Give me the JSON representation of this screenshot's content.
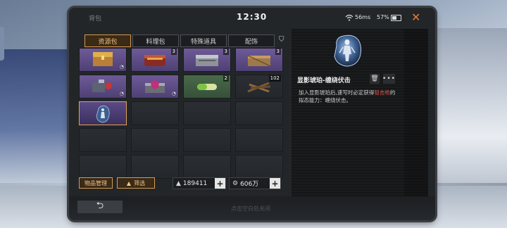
{
  "status": {
    "title": "背包",
    "time": "12:30",
    "ping": "56ms",
    "battery": "57%",
    "battery_level": 0.57
  },
  "tabs": [
    {
      "label": "资源包",
      "active": true
    },
    {
      "label": "料理包",
      "active": false
    },
    {
      "label": "特殊道具",
      "active": false
    },
    {
      "label": "配饰",
      "active": false
    }
  ],
  "grid": [
    {
      "row": 0,
      "col": 0,
      "kind": "purple",
      "icon": "treasure-chest-icon",
      "qty": "",
      "check": true
    },
    {
      "row": 0,
      "col": 1,
      "kind": "purple",
      "icon": "red-chest-icon",
      "qty": "3",
      "check": false
    },
    {
      "row": 0,
      "col": 2,
      "kind": "purple",
      "icon": "metal-case-icon",
      "qty": "3",
      "check": false
    },
    {
      "row": 0,
      "col": 3,
      "kind": "purple",
      "icon": "wooden-crate-icon",
      "qty": "3",
      "check": false
    },
    {
      "row": 1,
      "col": 0,
      "kind": "purple",
      "icon": "supply-bundle-icon",
      "qty": "",
      "check": true
    },
    {
      "row": 1,
      "col": 1,
      "kind": "purple",
      "icon": "shield-box-icon",
      "qty": "",
      "check": true
    },
    {
      "row": 1,
      "col": 2,
      "kind": "green",
      "icon": "capsule-icon",
      "qty": "2",
      "check": false
    },
    {
      "row": 1,
      "col": 3,
      "kind": "plain",
      "icon": "wood-pile-icon",
      "qty": "102",
      "check": false
    },
    {
      "row": 2,
      "col": 0,
      "kind": "selected",
      "icon": "amber-icon",
      "qty": "",
      "check": false
    }
  ],
  "buttons": {
    "manage": "物品管理",
    "filter": "筛选"
  },
  "currency": {
    "coins": "189411",
    "tokens": "606万"
  },
  "detail": {
    "name": "显影琥珀-缠绕伏击",
    "desc_before": "加入显影琥珀后,速写时必定获得",
    "desc_highlight": "狙击枪",
    "desc_after": "的拟态能力：缠绕伏击。"
  },
  "footer": {
    "hint": "点击空白处关闭"
  },
  "colors": {
    "accent": "#d49a52",
    "highlight": "#e0574c",
    "close": "#e67a3c"
  }
}
